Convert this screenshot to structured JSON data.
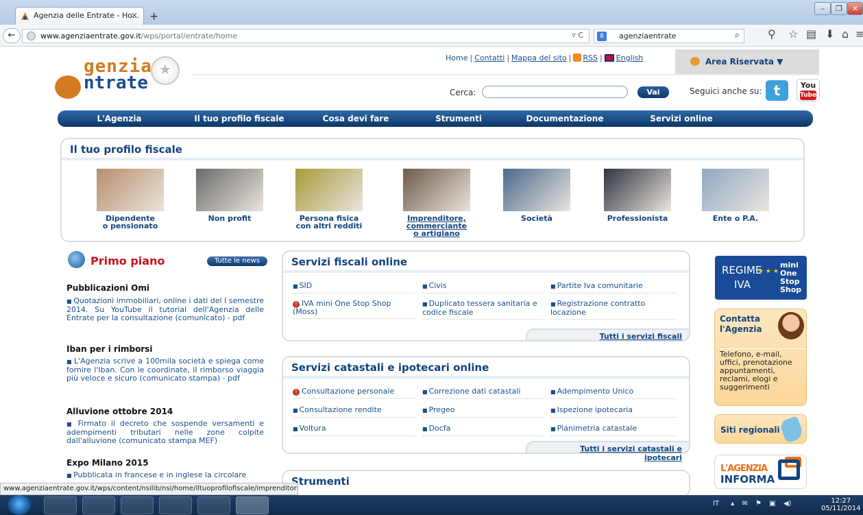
{
  "browser": {
    "tab_title": "Agenzia delle Entrate - Ho...",
    "tab_close": "×",
    "new_tab": "+",
    "url_host": "www.agenziaentrate.gov.it",
    "url_path": "/wps/portal/entrate/home",
    "search_value": "agenziaentrate",
    "status_url": "www.agenziaentrate.gov.it/wps/content/nsilib/nsi/home/iltuoprofilofiscale/imprenditori"
  },
  "header": {
    "logo_line1": "genzia",
    "logo_line2": "ntrate",
    "links": [
      "Home",
      "Contatti",
      "Mappa del sito",
      "RSS",
      "English"
    ],
    "area_riservata": "Area Riservata ▼",
    "search_label": "Cerca:",
    "search_placeholder": "",
    "search_button": "Vai",
    "follow_label": "Seguici anche su:",
    "youtube_top": "You",
    "youtube_bottom": "Tube"
  },
  "menu": [
    "L'Agenzia",
    "Il tuo profilo fiscale",
    "Cosa devi fare",
    "Strumenti",
    "Documentazione",
    "Servizi online"
  ],
  "profile": {
    "title": "Il tuo profilo fiscale",
    "cards": [
      {
        "line1": "Dipendente",
        "line2": "o pensionato",
        "line3": "",
        "color": "#b98e6c"
      },
      {
        "line1": "Non profit",
        "line2": "",
        "line3": "",
        "color": "#6b6b6b"
      },
      {
        "line1": "Persona fisica",
        "line2": "con altri redditi",
        "line3": "",
        "color": "#a89a3c"
      },
      {
        "line1": "Imprenditore,",
        "line2": "commerciante",
        "line3": "o artigiano",
        "color": "#6f5a48"
      },
      {
        "line1": "Società",
        "line2": "",
        "line3": "",
        "color": "#4a6a8c"
      },
      {
        "line1": "Professionista",
        "line2": "",
        "line3": "",
        "color": "#2f3540"
      },
      {
        "line1": "Ente o P.A.",
        "line2": "",
        "line3": "",
        "color": "#8fa9c4"
      }
    ]
  },
  "news": {
    "title": "Primo piano",
    "all_button": "Tutte le news",
    "items": [
      {
        "head": "Pubblicazioni Omi",
        "text": "Quotazioni immobiliari, online i dati del I semestre 2014. Su YouTube il tutorial dell'Agenzia delle Entrate per la consultazione (comunicato) - pdf"
      },
      {
        "head": "Iban per i rimborsi",
        "text": "L'Agenzia scrive a 100mila società e spiega come fornire l'Iban. Con le coordinate, il rimborso viaggia più veloce e sicuro (comunicato stampa) - pdf"
      },
      {
        "head": "Alluvione ottobre 2014",
        "text": "Firmato il decreto che sospende versamenti e adempimenti tributari nelle zone colpite dall'alluvione (comunicato stampa MEF)"
      },
      {
        "head": "Expo Milano 2015",
        "text": "Pubblicata in francese e in inglese la circolare"
      }
    ]
  },
  "servizi_fiscali": {
    "title": "Servizi fiscali online",
    "items": [
      "SID",
      "Civis",
      "Partite Iva comunitarie",
      "IVA mini One Stop Shop (Moss)",
      "Duplicato tessera sanitaria e codice fiscale",
      "Registrazione contratto locazione"
    ],
    "all": "Tutti i servizi fiscali"
  },
  "servizi_catastali": {
    "title": "Servizi catastali e ipotecari online",
    "items": [
      "Consultazione personale",
      "Correzione dati catastali",
      "Adempimento Unico",
      "Consultazione rendite",
      "Pregeo",
      "Ispezione ipotecaria",
      "Voltura",
      "Docfa",
      "Planimetria catastale"
    ],
    "all": "Tutti i servizi catastali e ipotecari"
  },
  "strumenti": {
    "title": "Strumenti"
  },
  "right": {
    "regime_l1": "REGIME",
    "regime_l2": "IVA",
    "regime_l3": "mini One Stop Shop",
    "contatta_title": "Contatta l'Agenzia",
    "contatta_text": "Telefono, e-mail, uffici, prenotazione appuntamenti, reclami, elogi e suggerimenti",
    "siti": "Siti regionali",
    "informa_l1": "L'AGENZIA",
    "informa_l2": "INFORMA"
  },
  "taskbar": {
    "lang": "IT",
    "time": "12:27",
    "date": "05/11/2014"
  }
}
